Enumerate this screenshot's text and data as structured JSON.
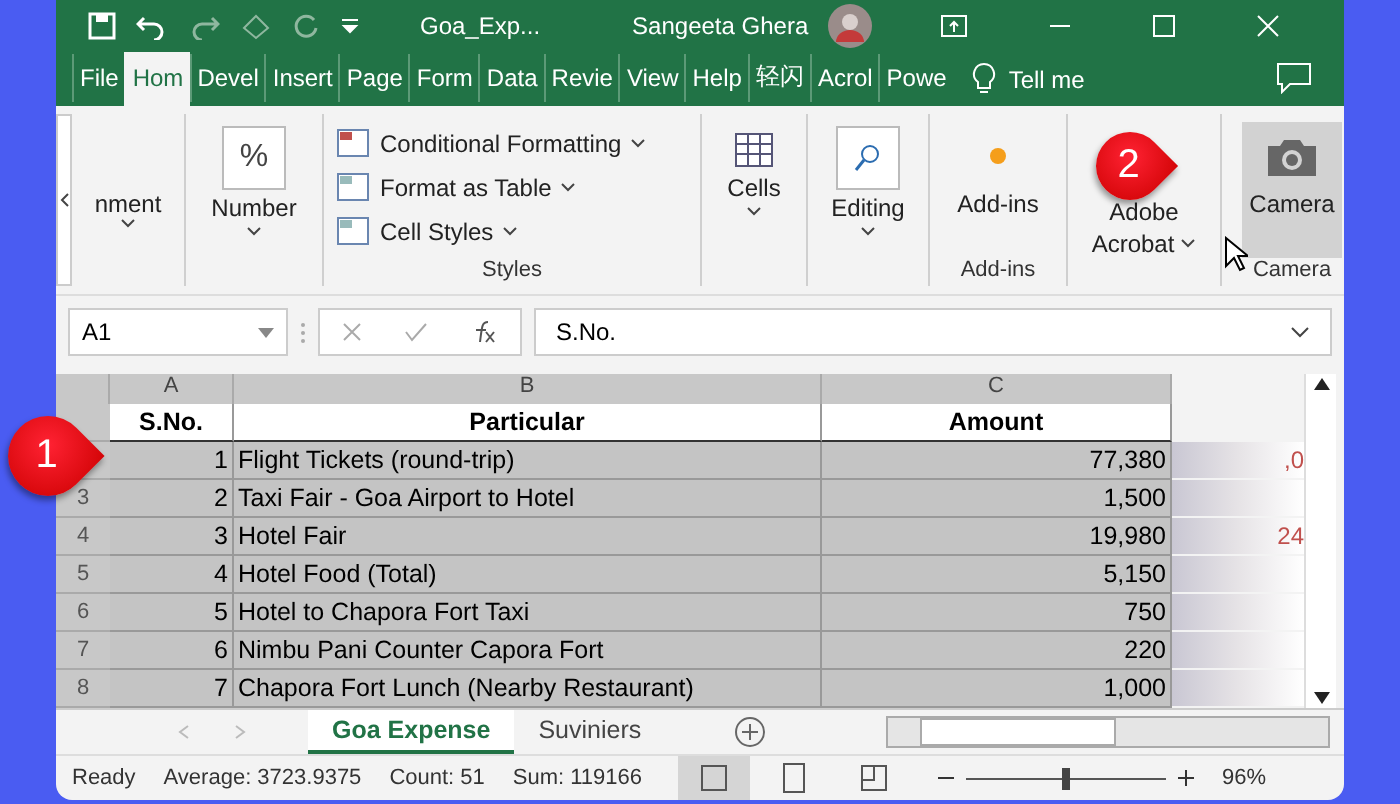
{
  "title_bar": {
    "filename": "Goa_Exp...",
    "user": "Sangeeta Ghera"
  },
  "ribbon_tabs": [
    {
      "label": "File",
      "selected": false
    },
    {
      "label": "Hom",
      "selected": true
    },
    {
      "label": "Devel",
      "selected": false
    },
    {
      "label": "Insert",
      "selected": false
    },
    {
      "label": "Page",
      "selected": false
    },
    {
      "label": "Form",
      "selected": false
    },
    {
      "label": "Data",
      "selected": false
    },
    {
      "label": "Revie",
      "selected": false
    },
    {
      "label": "View",
      "selected": false
    },
    {
      "label": "Help",
      "selected": false
    },
    {
      "label": "轻闪",
      "selected": false
    },
    {
      "label": "Acrol",
      "selected": false
    },
    {
      "label": "Powe",
      "selected": false
    }
  ],
  "tell_me": "Tell me",
  "ribbon": {
    "alignment": "nment",
    "number_icon": "%",
    "number": "Number",
    "styles": [
      "Conditional Formatting",
      "Format as Table",
      "Cell Styles"
    ],
    "styles_group": "Styles",
    "cells": "Cells",
    "editing": "Editing",
    "addins": "Add-ins",
    "addins_group": "Add-ins",
    "acrobat": [
      "Adobe",
      "Acrobat"
    ],
    "camera": {
      "label": "Camera",
      "selected": true
    },
    "camera_group": "Camera"
  },
  "formula_bar": {
    "name_box": "A1",
    "value": "S.No."
  },
  "columns": [
    "A",
    "B",
    "C"
  ],
  "header": [
    "S.No.",
    "Particular",
    "Amount"
  ],
  "rows": [
    {
      "row": "",
      "cells": [
        "1",
        "Flight Tickets (round-trip)",
        "77,380"
      ],
      "column_4": ",0"
    },
    {
      "row": "3",
      "cells": [
        "2",
        "Taxi Fair - Goa Airport to Hotel",
        "1,500"
      ],
      "column_4": ""
    },
    {
      "row": "4",
      "cells": [
        "3",
        "Hotel Fair",
        "19,980"
      ],
      "column_4": "24"
    },
    {
      "row": "5",
      "cells": [
        "4",
        "Hotel Food (Total)",
        "5,150"
      ],
      "column_4": ""
    },
    {
      "row": "6",
      "cells": [
        "5",
        "Hotel to Chapora Fort Taxi",
        "750"
      ],
      "column_4": ""
    },
    {
      "row": "7",
      "cells": [
        "6",
        "Nimbu Pani Counter Capora Fort",
        "220"
      ],
      "column_4": ""
    },
    {
      "row": "8",
      "cells": [
        "7",
        "Chapora Fort Lunch (Nearby Restaurant)",
        "1,000"
      ],
      "column_4": ""
    }
  ],
  "sheets": [
    {
      "label": "Goa Expense",
      "selected": true
    },
    {
      "label": "Suviniers",
      "selected": false
    }
  ],
  "status_bar": {
    "state": "Ready",
    "stats": [
      "Average: 3723.9375",
      "Count: 51",
      "Sum: 119166"
    ],
    "views": [
      {
        "kind": "normal",
        "selected": true
      },
      {
        "kind": "layout",
        "selected": false
      },
      {
        "kind": "break",
        "selected": false
      }
    ],
    "zoom": {
      "level": 0.48,
      "reading": "96%"
    }
  },
  "callouts": [
    {
      "number": "1"
    },
    {
      "number": "2"
    }
  ]
}
